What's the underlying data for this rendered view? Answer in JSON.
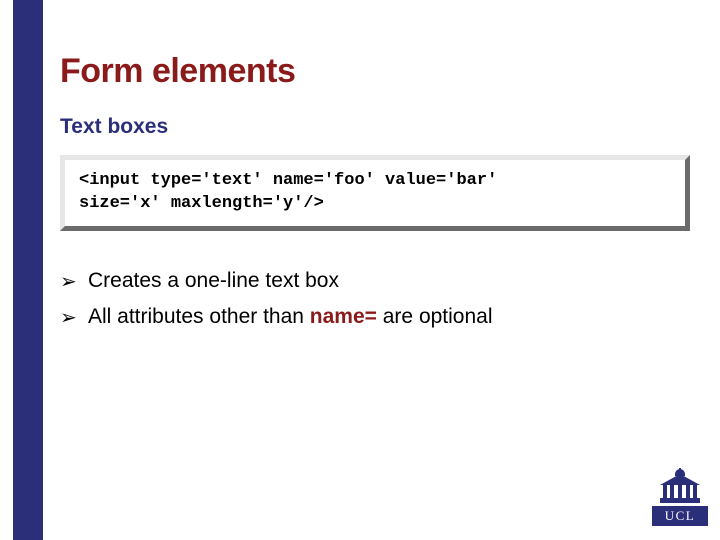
{
  "title": "Form elements",
  "subtitle": "Text boxes",
  "code": "<input type='text' name='foo' value='bar'\nsize='x' maxlength='y'/>",
  "bullets": [
    {
      "pre": "Creates a one-line text box",
      "code": "",
      "post": ""
    },
    {
      "pre": "All attributes other than ",
      "code": "name=",
      "post": " are optional"
    }
  ],
  "logo_text": "UCL"
}
